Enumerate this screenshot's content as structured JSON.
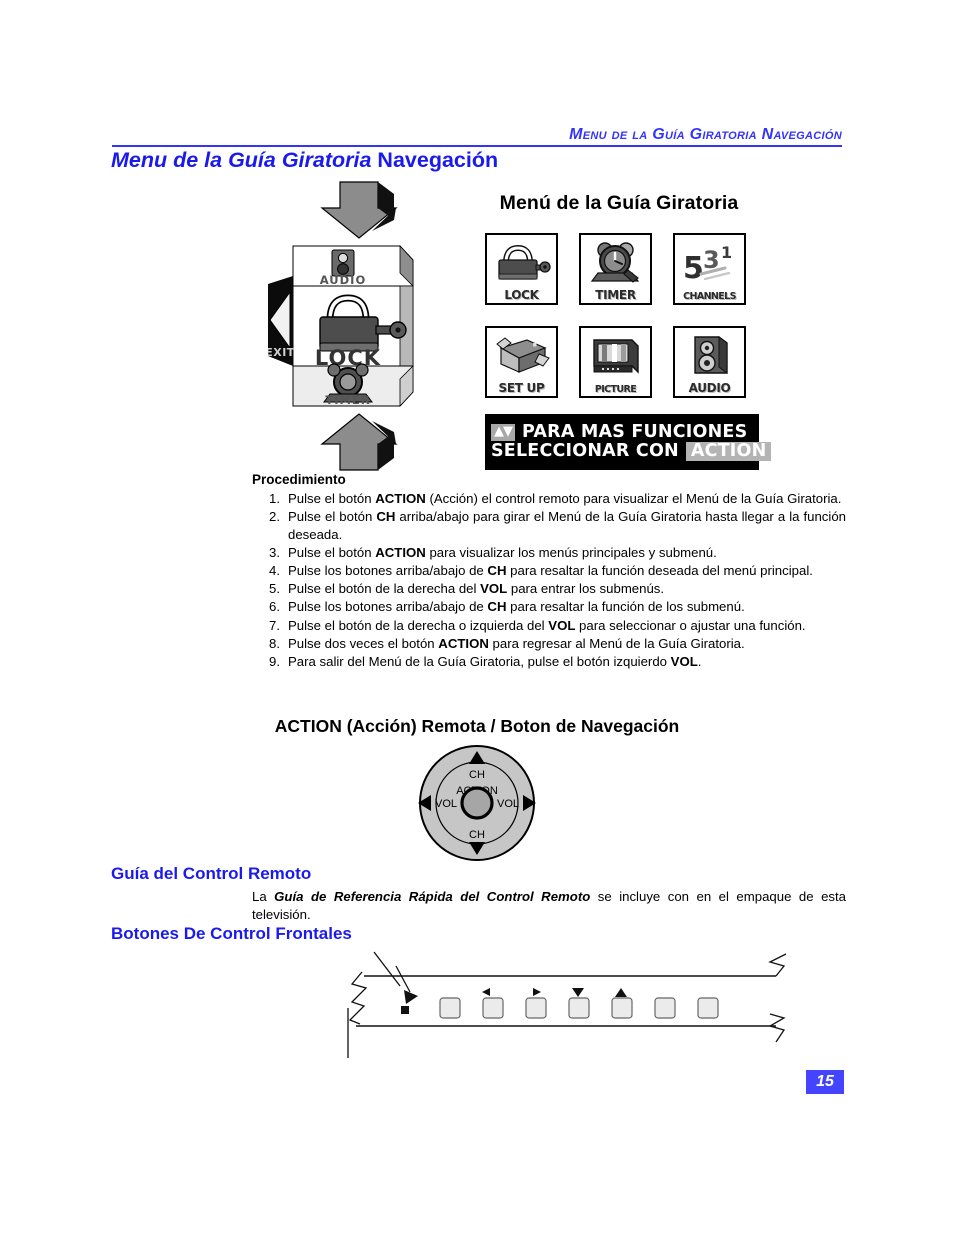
{
  "running_header": {
    "text": "Menu de la Guía Giratoria Navegación",
    "rule_color": "#3333ff",
    "text_color": "#3333ff"
  },
  "page_title": {
    "italic_part": "Menu de la Guía Giratoria",
    "regular_part": " Navegación",
    "color": "#1a1aee"
  },
  "carousel": {
    "top_label": "AUDIO",
    "center_label": "LOCK",
    "bottom_label": "TIMER",
    "exit_label": "EXIT"
  },
  "osd": {
    "title": "Menú de la Guía Giratoria",
    "icons": [
      {
        "label": "LOCK",
        "icon": "padlock-icon"
      },
      {
        "label": "TIMER",
        "icon": "alarm-clock-icon"
      },
      {
        "label": "CHANNELS",
        "icon": "channels-numbers-icon"
      },
      {
        "label": "SET UP",
        "icon": "open-box-icon"
      },
      {
        "label": "PICTURE",
        "icon": "television-icon"
      },
      {
        "label": "AUDIO",
        "icon": "speaker-icon"
      }
    ],
    "banner": {
      "arrows": "▲▼",
      "line1": "PARA MAS FUNCIONES",
      "line2a": "SELECCIONAR CON",
      "action_chip": "ACTION"
    }
  },
  "procedure": {
    "heading": "Procedimiento",
    "steps": [
      "Pulse el botón ACTION (Acción) el control remoto para visualizar el Menú de la Guía Giratoria.",
      "Pulse el botón CH arriba/abajo para girar el Menú de la Guía Giratoria hasta llegar a la función deseada.",
      "Pulse el botón ACTION para visualizar los menús principales y submenú.",
      "Pulse los botones arriba/abajo de CH para resaltar la función deseada del menú principal.",
      "Pulse el botón de la derecha del VOL para entrar los submenús.",
      "Pulse los botones arriba/abajo de CH para resaltar la función de los  submenú.",
      "Pulse el botón de la derecha o izquierda del VOL para seleccionar o ajustar una función.",
      "Pulse dos veces el botón ACTION para regresar al Menú de la Guía Giratoria.",
      "Para salir del Menú de la Guía Giratoria, pulse el botón izquierdo  VOL."
    ],
    "steps_html": [
      "Pulse el botón <b>ACTION</b> (Acción) el control remoto para visualizar el Menú de la Guía Giratoria.",
      "Pulse el botón <b>CH</b> arriba/abajo para girar el Menú de la Guía Giratoria hasta llegar a la función deseada.",
      "Pulse el botón <b>ACTION</b> para visualizar los menús principales y submenú.",
      "Pulse los botones arriba/abajo de <b>CH</b> para resaltar la función deseada del menú principal.",
      "Pulse el botón de la derecha del <b>VOL</b> para entrar los submenús.",
      "Pulse los botones arriba/abajo de <b>CH</b> para resaltar la función de los  submenú.",
      "Pulse el botón de la derecha o izquierda del <b>VOL</b> para seleccionar o ajustar una función.",
      "Pulse dos veces el botón <b>ACTION</b> para regresar al Menú de la Guía Giratoria.",
      "Para salir del Menú de la Guía Giratoria, pulse el botón izquierdo  <b>VOL</b>."
    ]
  },
  "navigation": {
    "title": "ACTION (Acción) Remota / Boton de Navegación",
    "ring": {
      "up_label": "CH",
      "down_label": "CH",
      "left_label": "VOL",
      "right_label": "VOL",
      "center_label": "ACTION"
    }
  },
  "remote_guide": {
    "heading": "Guía del  Control Remoto",
    "body_html": "La <i>Guía de Referencia Rápida del Control Remoto</i> se incluye con en el empaque de esta televisión.",
    "body_text": "La Guía de Referencia Rápida del Control Remoto se incluye con en el empaque de esta televisión."
  },
  "front_buttons": {
    "heading": "Botones De Control Frontales",
    "button_count": 7,
    "markers": [
      "right-triangle",
      "left-triangle",
      "right-triangle",
      "down-triangle",
      "up-triangle"
    ]
  },
  "page_number": {
    "value": "15",
    "background": "#4444ff",
    "color": "#ffffff"
  }
}
